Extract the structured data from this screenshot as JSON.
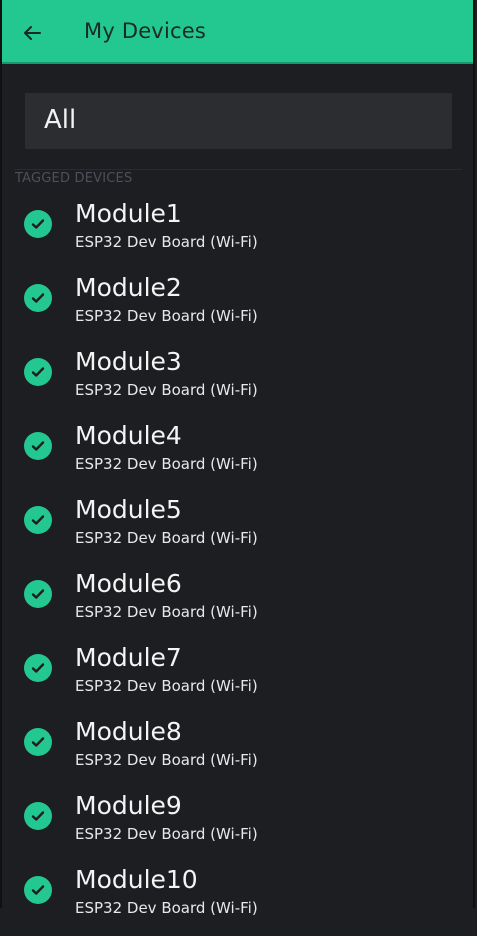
{
  "header": {
    "title": "My Devices",
    "back_icon": "arrow-back-icon"
  },
  "filter": {
    "value": "All"
  },
  "section_label": "TAGGED DEVICES",
  "devices": [
    {
      "name": "Module1",
      "board": "ESP32 Dev Board (Wi-Fi)"
    },
    {
      "name": "Module2",
      "board": "ESP32 Dev Board (Wi-Fi)"
    },
    {
      "name": "Module3",
      "board": "ESP32 Dev Board (Wi-Fi)"
    },
    {
      "name": "Module4",
      "board": "ESP32 Dev Board (Wi-Fi)"
    },
    {
      "name": "Module5",
      "board": "ESP32 Dev Board (Wi-Fi)"
    },
    {
      "name": "Module6",
      "board": "ESP32 Dev Board (Wi-Fi)"
    },
    {
      "name": "Module7",
      "board": "ESP32 Dev Board (Wi-Fi)"
    },
    {
      "name": "Module8",
      "board": "ESP32 Dev Board (Wi-Fi)"
    },
    {
      "name": "Module9",
      "board": "ESP32 Dev Board (Wi-Fi)"
    },
    {
      "name": "Module10",
      "board": "ESP32 Dev Board (Wi-Fi)"
    }
  ],
  "colors": {
    "accent": "#23c890",
    "background": "#1d1e22",
    "field": "#2c2d31"
  }
}
